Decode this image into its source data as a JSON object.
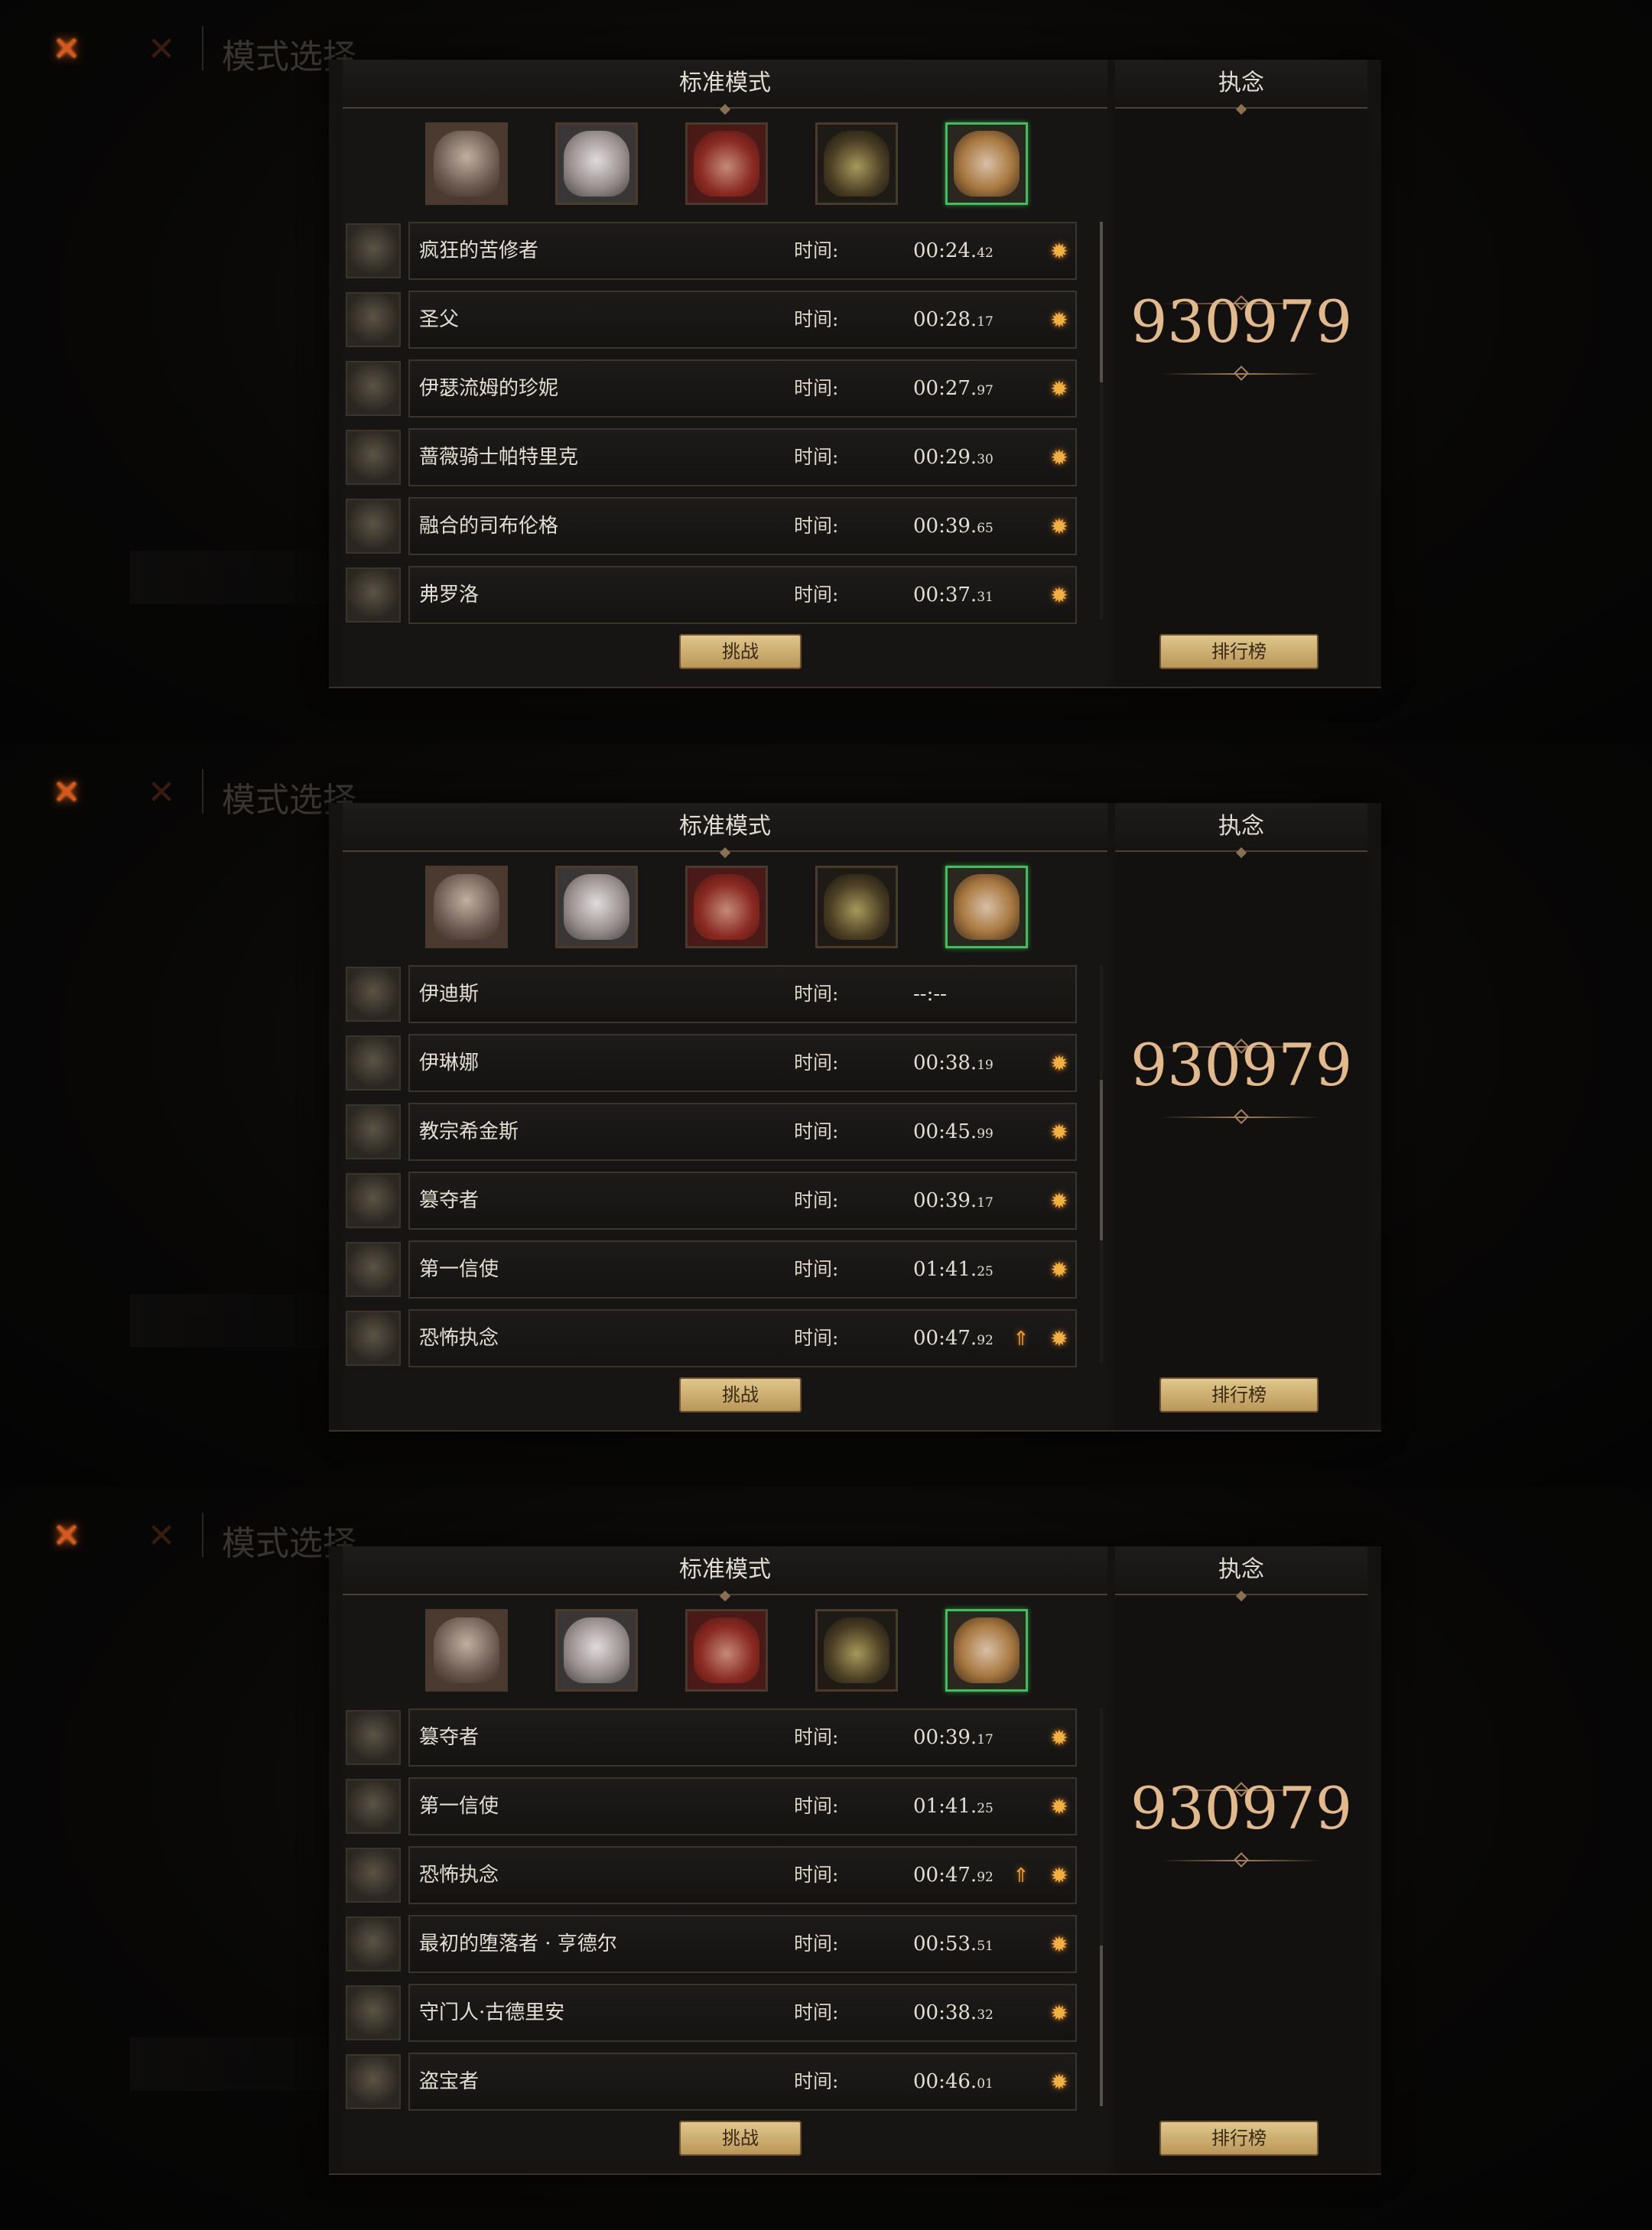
{
  "screens": [
    {
      "background": {
        "title": "模式选择"
      },
      "header": {
        "mode_title": "标准模式",
        "right_title": "执念"
      },
      "score": "930979",
      "buttons": {
        "challenge": "挑战",
        "leaderboard": "排行榜"
      },
      "rows": [
        {
          "name": "疯狂的苦修者",
          "time_label": "时间:",
          "time_main": "00:24.",
          "time_frac": "42",
          "upgrade": false
        },
        {
          "name": "圣父",
          "time_label": "时间:",
          "time_main": "00:28.",
          "time_frac": "17",
          "upgrade": false
        },
        {
          "name": "伊瑟流姆的珍妮",
          "time_label": "时间:",
          "time_main": "00:27.",
          "time_frac": "97",
          "upgrade": false
        },
        {
          "name": "蔷薇骑士帕特里克",
          "time_label": "时间:",
          "time_main": "00:29.",
          "time_frac": "30",
          "upgrade": false
        },
        {
          "name": "融合的司布伦格",
          "time_label": "时间:",
          "time_main": "00:39.",
          "time_frac": "65",
          "upgrade": false
        },
        {
          "name": "弗罗洛",
          "time_label": "时间:",
          "time_main": "00:37.",
          "time_frac": "31",
          "upgrade": false
        }
      ]
    },
    {
      "background": {
        "title": "模式选择"
      },
      "header": {
        "mode_title": "标准模式",
        "right_title": "执念"
      },
      "score": "930979",
      "buttons": {
        "challenge": "挑战",
        "leaderboard": "排行榜"
      },
      "rows": [
        {
          "name": "伊迪斯",
          "time_label": "时间:",
          "time_main": "--:--",
          "time_frac": "",
          "upgrade": false,
          "no_star": true
        },
        {
          "name": "伊琳娜",
          "time_label": "时间:",
          "time_main": "00:38.",
          "time_frac": "19",
          "upgrade": false
        },
        {
          "name": "教宗希金斯",
          "time_label": "时间:",
          "time_main": "00:45.",
          "time_frac": "99",
          "upgrade": false
        },
        {
          "name": "篡夺者",
          "time_label": "时间:",
          "time_main": "00:39.",
          "time_frac": "17",
          "upgrade": false
        },
        {
          "name": "第一信使",
          "time_label": "时间:",
          "time_main": "01:41.",
          "time_frac": "25",
          "upgrade": false
        },
        {
          "name": "恐怖执念",
          "time_label": "时间:",
          "time_main": "00:47.",
          "time_frac": "92",
          "upgrade": true
        }
      ]
    },
    {
      "background": {
        "title": "模式选择"
      },
      "header": {
        "mode_title": "标准模式",
        "right_title": "执念"
      },
      "score": "930979",
      "buttons": {
        "challenge": "挑战",
        "leaderboard": "排行榜"
      },
      "rows": [
        {
          "name": "篡夺者",
          "time_label": "时间:",
          "time_main": "00:39.",
          "time_frac": "17",
          "upgrade": false
        },
        {
          "name": "第一信使",
          "time_label": "时间:",
          "time_main": "01:41.",
          "time_frac": "25",
          "upgrade": false
        },
        {
          "name": "恐怖执念",
          "time_label": "时间:",
          "time_main": "00:47.",
          "time_frac": "92",
          "upgrade": true
        },
        {
          "name": "最初的堕落者 · 亨德尔",
          "time_label": "时间:",
          "time_main": "00:53.",
          "time_frac": "51",
          "upgrade": false
        },
        {
          "name": "守门人·古德里安",
          "time_label": "时间:",
          "time_main": "00:38.",
          "time_frac": "32",
          "upgrade": false
        },
        {
          "name": "盗宝者",
          "time_label": "时间:",
          "time_main": "00:46.",
          "time_frac": "01",
          "upgrade": false
        }
      ]
    }
  ],
  "icons": {
    "close": "close-x-icon",
    "rank_star": "sun-star-icon",
    "upgrade": "upgrade-arrow-icon"
  },
  "colors": {
    "accent_gold": "#e2b98a",
    "selected_border": "#3fbf5a",
    "button_gold": "#d4b57a"
  }
}
